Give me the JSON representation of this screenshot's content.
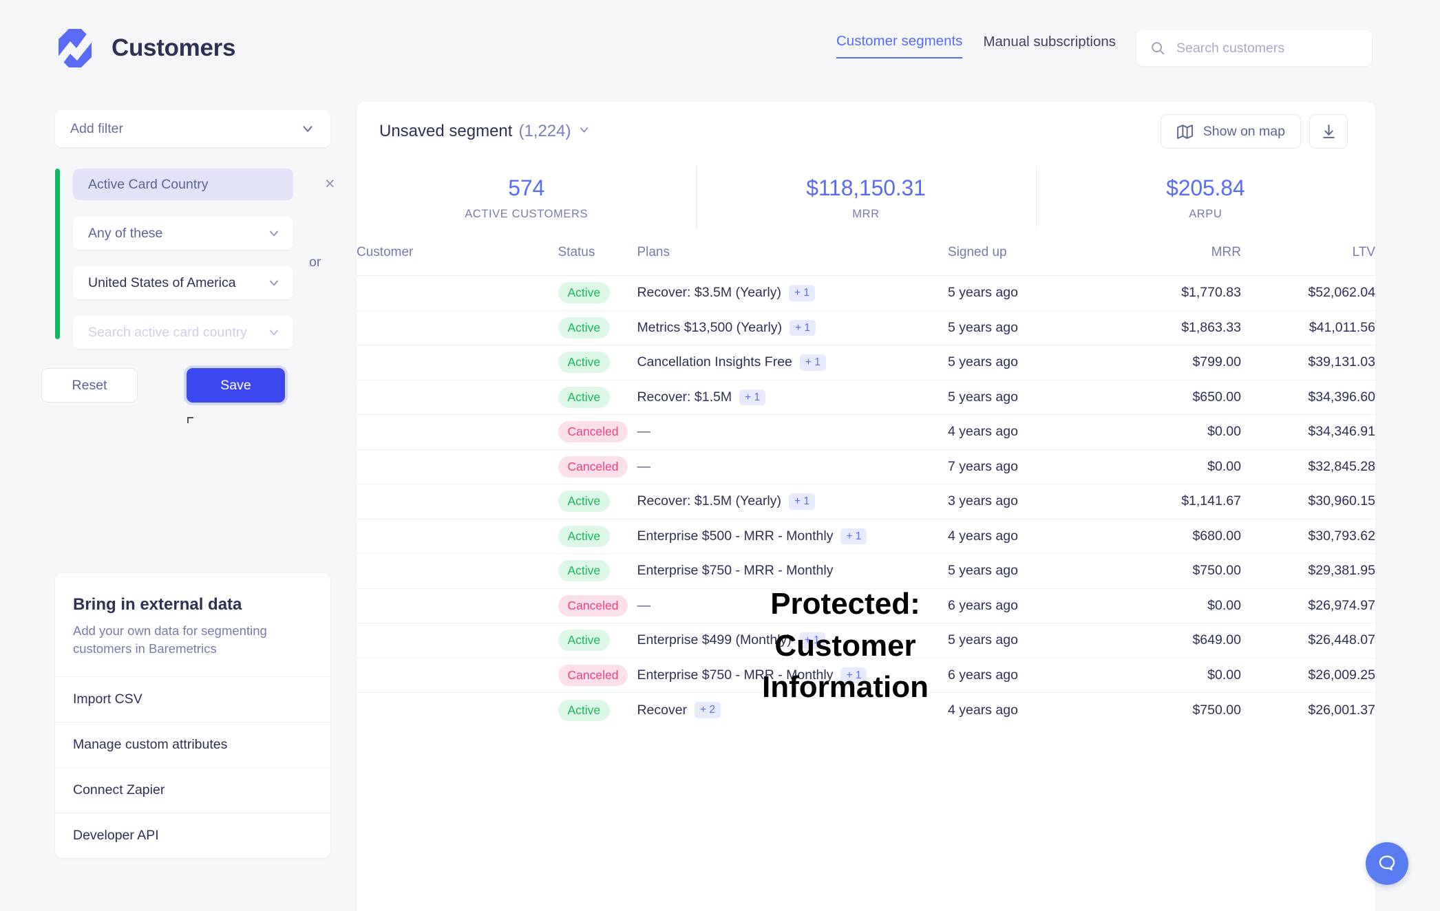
{
  "header": {
    "brand_title": "Customers",
    "nav": [
      {
        "label": "Customer segments",
        "active": true
      },
      {
        "label": "Manual subscriptions",
        "active": false
      }
    ],
    "search_placeholder": "Search customers"
  },
  "sidebar": {
    "add_filter_label": "Add filter",
    "filter": {
      "field_label": "Active Card Country",
      "operator_label": "Any of these",
      "value_label": "United States of America",
      "value_search_placeholder": "Search active card country",
      "or_label": "or",
      "accent_color": "#10b960"
    },
    "reset_label": "Reset",
    "save_label": "Save",
    "external": {
      "title": "Bring in external data",
      "subtitle": "Add your own data for segmenting customers in Baremetrics",
      "items": [
        "Import CSV",
        "Manage custom attributes",
        "Connect Zapier",
        "Developer API"
      ]
    }
  },
  "main": {
    "segment_name": "Unsaved segment",
    "segment_count": "(1,224)",
    "show_on_map_label": "Show on map",
    "kpis": [
      {
        "value": "574",
        "label": "ACTIVE CUSTOMERS"
      },
      {
        "value": "$118,150.31",
        "label": "MRR"
      },
      {
        "value": "$205.84",
        "label": "ARPU"
      }
    ],
    "columns": [
      "Customer",
      "Status",
      "Plans",
      "Signed up",
      "MRR",
      "LTV"
    ],
    "rows": [
      {
        "status": "Active",
        "plan": "Recover: $3.5M (Yearly)",
        "extra": "+ 1",
        "signed_up": "5 years ago",
        "mrr": "$1,770.83",
        "ltv": "$52,062.04"
      },
      {
        "status": "Active",
        "plan": "Metrics $13,500 (Yearly)",
        "extra": "+ 1",
        "signed_up": "5 years ago",
        "mrr": "$1,863.33",
        "ltv": "$41,011.56"
      },
      {
        "status": "Active",
        "plan": "Cancellation Insights Free",
        "extra": "+ 1",
        "signed_up": "5 years ago",
        "mrr": "$799.00",
        "ltv": "$39,131.03"
      },
      {
        "status": "Active",
        "plan": "Recover: $1.5M",
        "extra": "+ 1",
        "signed_up": "5 years ago",
        "mrr": "$650.00",
        "ltv": "$34,396.60"
      },
      {
        "status": "Canceled",
        "plan": "—",
        "extra": "",
        "signed_up": "4 years ago",
        "mrr": "$0.00",
        "ltv": "$34,346.91"
      },
      {
        "status": "Canceled",
        "plan": "—",
        "extra": "",
        "signed_up": "7 years ago",
        "mrr": "$0.00",
        "ltv": "$32,845.28"
      },
      {
        "status": "Active",
        "plan": "Recover: $1.5M (Yearly)",
        "extra": "+ 1",
        "signed_up": "3 years ago",
        "mrr": "$1,141.67",
        "ltv": "$30,960.15"
      },
      {
        "status": "Active",
        "plan": "Enterprise $500 - MRR - Monthly",
        "extra": "+ 1",
        "signed_up": "4 years ago",
        "mrr": "$680.00",
        "ltv": "$30,793.62"
      },
      {
        "status": "Active",
        "plan": "Enterprise $750 - MRR - Monthly",
        "extra": "",
        "signed_up": "5 years ago",
        "mrr": "$750.00",
        "ltv": "$29,381.95"
      },
      {
        "status": "Canceled",
        "plan": "—",
        "extra": "",
        "signed_up": "6 years ago",
        "mrr": "$0.00",
        "ltv": "$26,974.97"
      },
      {
        "status": "Active",
        "plan": "Enterprise $499 (Monthly)",
        "extra": "+ 1",
        "signed_up": "5 years ago",
        "mrr": "$649.00",
        "ltv": "$26,448.07"
      },
      {
        "status": "Canceled",
        "plan": "Enterprise $750 - MRR - Monthly",
        "extra": "+ 1",
        "signed_up": "6 years ago",
        "mrr": "$0.00",
        "ltv": "$26,009.25"
      },
      {
        "status": "Active",
        "plan": "Recover",
        "extra": "+ 2",
        "signed_up": "4 years ago",
        "mrr": "$750.00",
        "ltv": "$26,001.37"
      }
    ],
    "protected_overlay": "Protected: Customer Information"
  },
  "colors": {
    "accent": "#5a6bf5",
    "primary_button": "#3b47ef",
    "active_badge_text": "#17b85c",
    "active_badge_bg": "#dcf7e6",
    "canceled_badge_text": "#f0407c",
    "canceled_badge_bg": "#fbe0ea",
    "filter_accent": "#10b960",
    "help_button": "#5a7cf2"
  }
}
